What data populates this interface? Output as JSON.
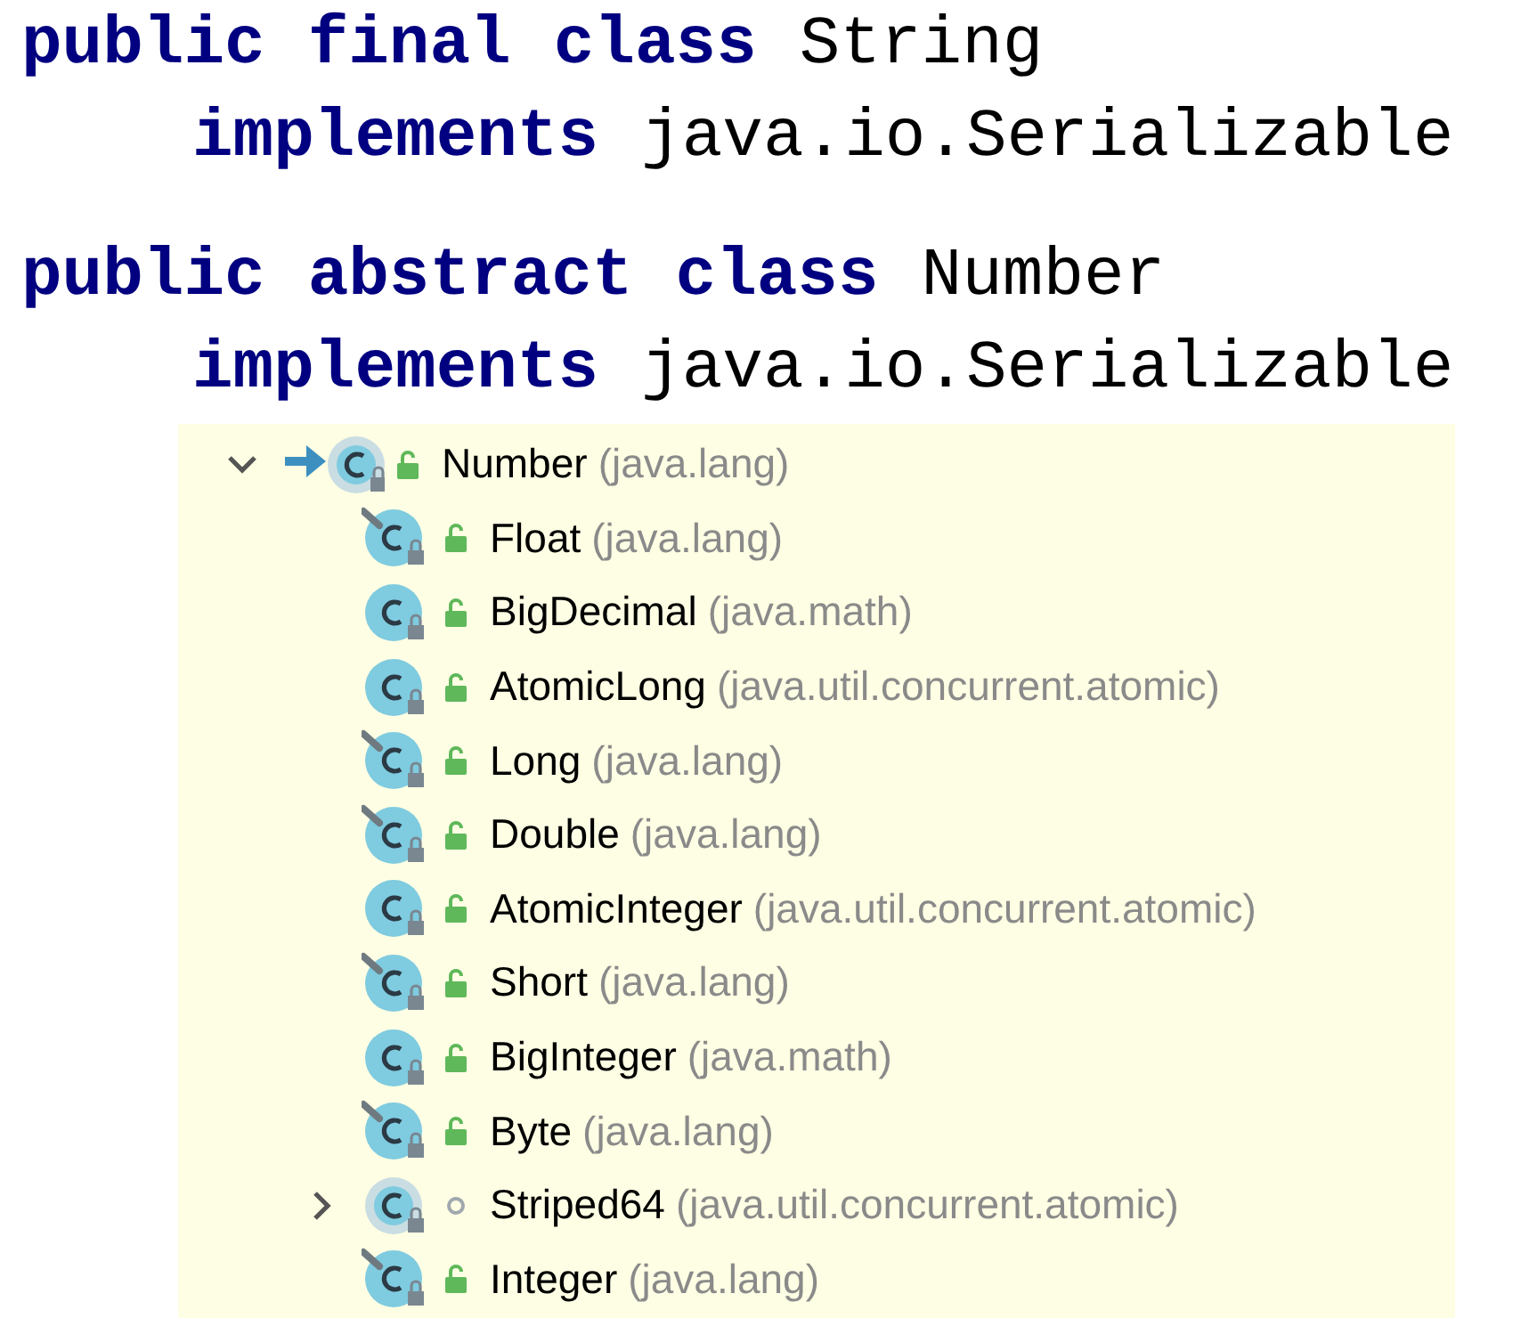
{
  "code_blocks": [
    {
      "lines": [
        {
          "indented": false,
          "tokens": [
            {
              "text": "public",
              "kind": "keyword"
            },
            {
              "text": "final",
              "kind": "keyword"
            },
            {
              "text": "class",
              "kind": "keyword"
            },
            {
              "text": "String",
              "kind": "plain"
            }
          ]
        },
        {
          "indented": true,
          "tokens": [
            {
              "text": "implements",
              "kind": "keyword"
            },
            {
              "text": "java.io.Serializable",
              "kind": "plain"
            }
          ]
        }
      ]
    },
    {
      "lines": [
        {
          "indented": false,
          "tokens": [
            {
              "text": "public",
              "kind": "keyword"
            },
            {
              "text": "abstract",
              "kind": "keyword"
            },
            {
              "text": "class",
              "kind": "keyword"
            },
            {
              "text": "Number",
              "kind": "plain"
            }
          ]
        },
        {
          "indented": true,
          "tokens": [
            {
              "text": "implements",
              "kind": "keyword"
            },
            {
              "text": "java.io.Serializable",
              "kind": "plain"
            }
          ]
        }
      ]
    }
  ],
  "hierarchy": {
    "name": "Number",
    "package": "(java.lang)",
    "kind": "abstract",
    "is_public": true,
    "current": true,
    "expanded": true,
    "children": [
      {
        "name": "Float",
        "package": "(java.lang)",
        "kind": "final",
        "is_public": true
      },
      {
        "name": "BigDecimal",
        "package": "(java.math)",
        "kind": "class",
        "is_public": true
      },
      {
        "name": "AtomicLong",
        "package": "(java.util.concurrent.atomic)",
        "kind": "class",
        "is_public": true
      },
      {
        "name": "Long",
        "package": "(java.lang)",
        "kind": "final",
        "is_public": true
      },
      {
        "name": "Double",
        "package": "(java.lang)",
        "kind": "final",
        "is_public": true
      },
      {
        "name": "AtomicInteger",
        "package": "(java.util.concurrent.atomic)",
        "kind": "class",
        "is_public": true
      },
      {
        "name": "Short",
        "package": "(java.lang)",
        "kind": "final",
        "is_public": true
      },
      {
        "name": "BigInteger",
        "package": "(java.math)",
        "kind": "class",
        "is_public": true
      },
      {
        "name": "Byte",
        "package": "(java.lang)",
        "kind": "final",
        "is_public": true
      },
      {
        "name": "Striped64",
        "package": "(java.util.concurrent.atomic)",
        "kind": "abstract",
        "is_public": false,
        "expanded": false
      },
      {
        "name": "Integer",
        "package": "(java.lang)",
        "kind": "final",
        "is_public": true
      }
    ]
  }
}
